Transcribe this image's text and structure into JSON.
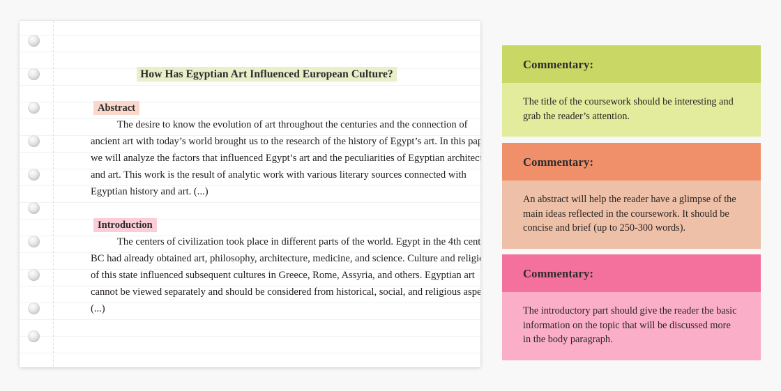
{
  "background_color": "#f8f8f8",
  "page": {
    "title": "How Has Egyptian Art Influenced European Culture?",
    "title_highlight_color": "#e9efc9",
    "sections": [
      {
        "heading": "Abstract",
        "heading_highlight_color": "#fad9cc",
        "body": "The desire to know the evolution of art throughout the centuries and the connection of ancient art with today’s world brought us to the research of the history of Egypt’s art. In this paper we will analyze the factors that influenced Egypt’s art and the peculiarities of Egyptian architecture and art. This work is the result of analytic work with various literary sources connected with Egyptian history and art. (...)"
      },
      {
        "heading": "Introduction",
        "heading_highlight_color": "#fbcdd8",
        "body": "The centers of civilization took place in different parts of the world. Egypt in the 4th century BC had already obtained art, philosophy, architecture, medicine, and science. Culture and religion of this state influenced subsequent cultures in Greece, Rome, Assyria, and others. Egyptian art cannot be viewed separately and should be considered from historical, social, and religious aspects. (...)"
      }
    ],
    "ruled_line_color": "#eef4f3",
    "margin_rule_color": "#e9d8d8",
    "hole_count": 10
  },
  "commentary_cards": [
    {
      "header": "Commentary:",
      "body": "The title of the coursework should be interesting and grab the reader’s attention.",
      "header_color": "#c9d764",
      "body_color": "#e3eb9c"
    },
    {
      "header": "Commentary:",
      "body": "An abstract will help the reader have a glimpse of the main ideas reflected in the coursework. It should be concise and brief (up to 250-300 words).",
      "header_color": "#f0906a",
      "body_color": "#efc0a8"
    },
    {
      "header": "Commentary:",
      "body": "The introductory part should give the reader the basic information on the topic that will be discussed more in the body paragraph.",
      "header_color": "#f4719e",
      "body_color": "#fbaec8"
    }
  ]
}
